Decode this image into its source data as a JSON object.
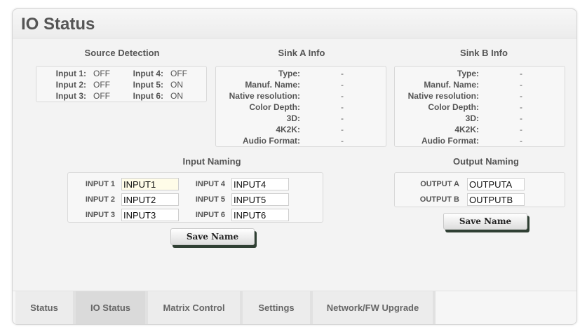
{
  "page_title": "IO Status",
  "source_detection": {
    "title": "Source Detection",
    "inputs": [
      {
        "label": "Input 1:",
        "value": "OFF"
      },
      {
        "label": "Input 2:",
        "value": "OFF"
      },
      {
        "label": "Input 3:",
        "value": "OFF"
      },
      {
        "label": "Input 4:",
        "value": "OFF"
      },
      {
        "label": "Input 5:",
        "value": "ON"
      },
      {
        "label": "Input 6:",
        "value": "ON"
      }
    ]
  },
  "sink_a": {
    "title": "Sink A Info",
    "rows": [
      {
        "label": "Type:",
        "value": "-"
      },
      {
        "label": "Manuf. Name:",
        "value": "-"
      },
      {
        "label": "Native resolution:",
        "value": "-"
      },
      {
        "label": "Color Depth:",
        "value": "-"
      },
      {
        "label": "3D:",
        "value": "-"
      },
      {
        "label": "4K2K:",
        "value": "-"
      },
      {
        "label": "Audio Format:",
        "value": "-"
      }
    ]
  },
  "sink_b": {
    "title": "Sink B Info",
    "rows": [
      {
        "label": "Type:",
        "value": "-"
      },
      {
        "label": "Manuf. Name:",
        "value": "-"
      },
      {
        "label": "Native resolution:",
        "value": "-"
      },
      {
        "label": "Color Depth:",
        "value": "-"
      },
      {
        "label": "3D:",
        "value": "-"
      },
      {
        "label": "4K2K:",
        "value": "-"
      },
      {
        "label": "Audio Format:",
        "value": "-"
      }
    ]
  },
  "input_naming": {
    "title": "Input Naming",
    "fields": [
      {
        "label": "INPUT 1",
        "value": "INPUT1"
      },
      {
        "label": "INPUT 2",
        "value": "INPUT2"
      },
      {
        "label": "INPUT 3",
        "value": "INPUT3"
      },
      {
        "label": "INPUT 4",
        "value": "INPUT4"
      },
      {
        "label": "INPUT 5",
        "value": "INPUT5"
      },
      {
        "label": "INPUT 6",
        "value": "INPUT6"
      }
    ],
    "save_label": "Save Name"
  },
  "output_naming": {
    "title": "Output Naming",
    "fields": [
      {
        "label": "OUTPUT A",
        "value": "OUTPUTA"
      },
      {
        "label": "OUTPUT B",
        "value": "OUTPUTB"
      }
    ],
    "save_label": "Save Name"
  },
  "tabs": [
    {
      "label": "Status"
    },
    {
      "label": "IO Status",
      "active": true
    },
    {
      "label": "Matrix Control"
    },
    {
      "label": "Settings"
    },
    {
      "label": "Network/FW Upgrade"
    }
  ]
}
